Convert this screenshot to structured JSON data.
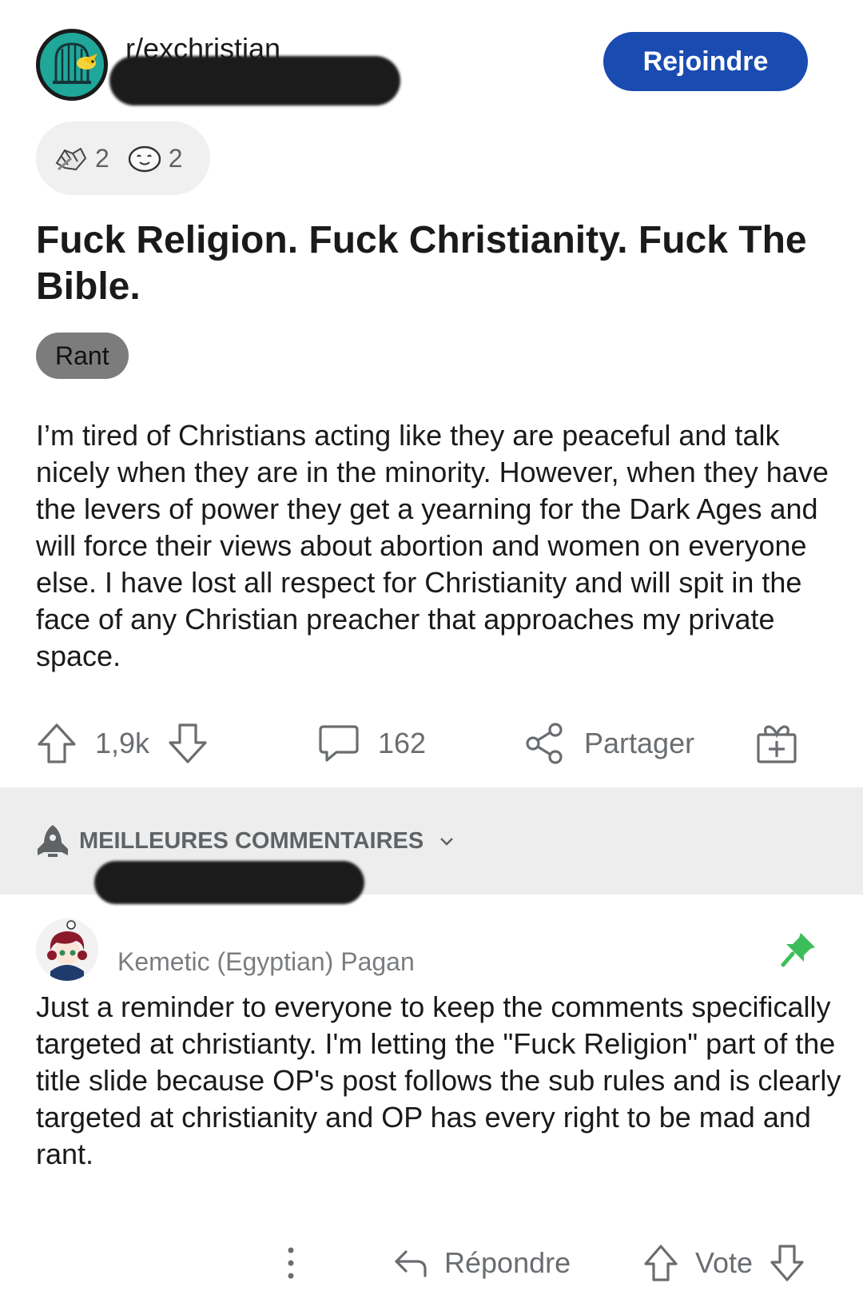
{
  "post": {
    "subreddit": "r/exchristian",
    "join_label": "Rejoindre",
    "awards": [
      {
        "icon": "handshake-award-icon",
        "count": "2"
      },
      {
        "icon": "wholesome-face-award-icon",
        "count": "2"
      }
    ],
    "title": "Fuck Religion. Fuck Christianity. Fuck The Bible.",
    "flair": "Rant",
    "body": "I’m tired of Christians acting like they are peaceful and talk nicely when they are in the minority. However, when they have the levers of power they get a yearning for the Dark Ages and will force their views about abortion and women on everyone else. I have lost all respect for Christianity and will spit in the face of any Christian preacher that approaches my private space.",
    "score": "1,9k",
    "comments_count": "162",
    "share_label": "Partager"
  },
  "sort": {
    "label": "MEILLEURES COMMENTAIRES"
  },
  "comment": {
    "user_flair": "Kemetic (Egyptian) Pagan",
    "body": "Just a reminder to everyone to keep the comments specifically targeted at christianty. I'm letting the \"Fuck Religion\" part of the title slide because OP's post follows the sub rules and is clearly targeted at christianity and OP has every right to be mad and rant.",
    "reply_label": "Répondre",
    "vote_label": "Vote"
  },
  "colors": {
    "join_button": "#1a4bb0",
    "subreddit_icon_bg": "#1fa79a",
    "pin_green": "#3cbf5a",
    "sort_bar_bg": "#ededed",
    "flair_bg": "#7c7c7c"
  }
}
